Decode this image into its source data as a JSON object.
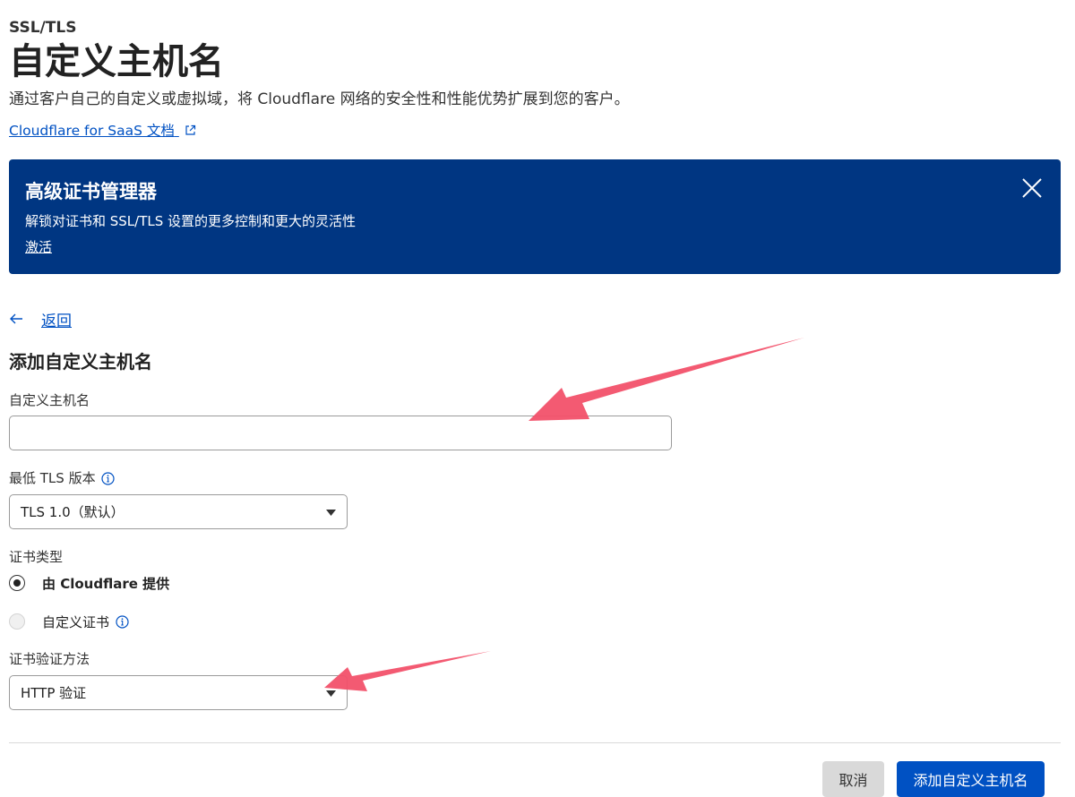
{
  "header": {
    "breadcrumb": "SSL/TLS",
    "title": "自定义主机名",
    "description": "通过客户自己的自定义或虚拟域，将 Cloudflare 网络的安全性和性能优势扩展到您的客户。",
    "doc_link": "Cloudflare for SaaS 文档"
  },
  "banner": {
    "title": "高级证书管理器",
    "text": "解锁对证书和 SSL/TLS 设置的更多控制和更大的灵活性",
    "activate": "激活",
    "background_color": "#003682"
  },
  "nav": {
    "back": "返回"
  },
  "form": {
    "section_title": "添加自定义主机名",
    "hostname_label": "自定义主机名",
    "hostname_value": "",
    "tls_label": "最低 TLS 版本",
    "tls_value": "TLS 1.0（默认）",
    "cert_type_label": "证书类型",
    "cert_type_options": [
      {
        "label": "由 Cloudflare 提供",
        "checked": true
      },
      {
        "label": "自定义证书",
        "checked": false
      }
    ],
    "validation_label": "证书验证方法",
    "validation_value": "HTTP 验证"
  },
  "actions": {
    "cancel": "取消",
    "submit": "添加自定义主机名",
    "accent_color": "#0051c3"
  },
  "icons": {
    "external_link": "external-link-icon",
    "close": "close-icon",
    "back_arrow": "arrow-left-icon",
    "info": "info-icon",
    "caret": "caret-down-icon",
    "annotation_arrow": "annotation-arrow"
  }
}
